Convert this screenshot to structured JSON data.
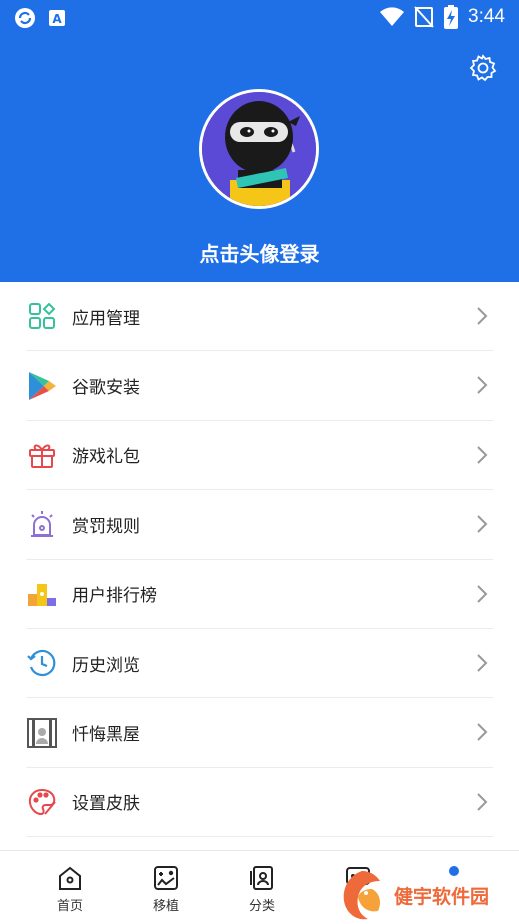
{
  "status_bar": {
    "time": "3:44",
    "icons": [
      "sync-icon",
      "font-icon",
      "wifi-icon",
      "no-signal-icon",
      "battery-charging-icon"
    ]
  },
  "header": {
    "login_text": "点击头像登录",
    "background_color": "#1f6fe6",
    "settings_icon": "gear-icon"
  },
  "menu": {
    "items": [
      {
        "label": "应用管理",
        "icon": "apps-grid-icon"
      },
      {
        "label": "谷歌安装",
        "icon": "play-store-icon"
      },
      {
        "label": "游戏礼包",
        "icon": "gift-icon"
      },
      {
        "label": "赏罚规则",
        "icon": "alarm-light-icon"
      },
      {
        "label": "用户排行榜",
        "icon": "ranking-icon"
      },
      {
        "label": "历史浏览",
        "icon": "history-icon"
      },
      {
        "label": "忏悔黑屋",
        "icon": "jail-icon"
      },
      {
        "label": "设置皮肤",
        "icon": "palette-icon"
      }
    ]
  },
  "bottom_nav": {
    "items": [
      {
        "label": "首页",
        "icon": "home-icon"
      },
      {
        "label": "移植",
        "icon": "gamepad-icon"
      },
      {
        "label": "分类",
        "icon": "category-icon"
      },
      {
        "label": "",
        "icon": "chat-icon"
      },
      {
        "label": "",
        "icon": "profile-icon"
      }
    ]
  },
  "watermark": {
    "text": "健宇软件园"
  }
}
